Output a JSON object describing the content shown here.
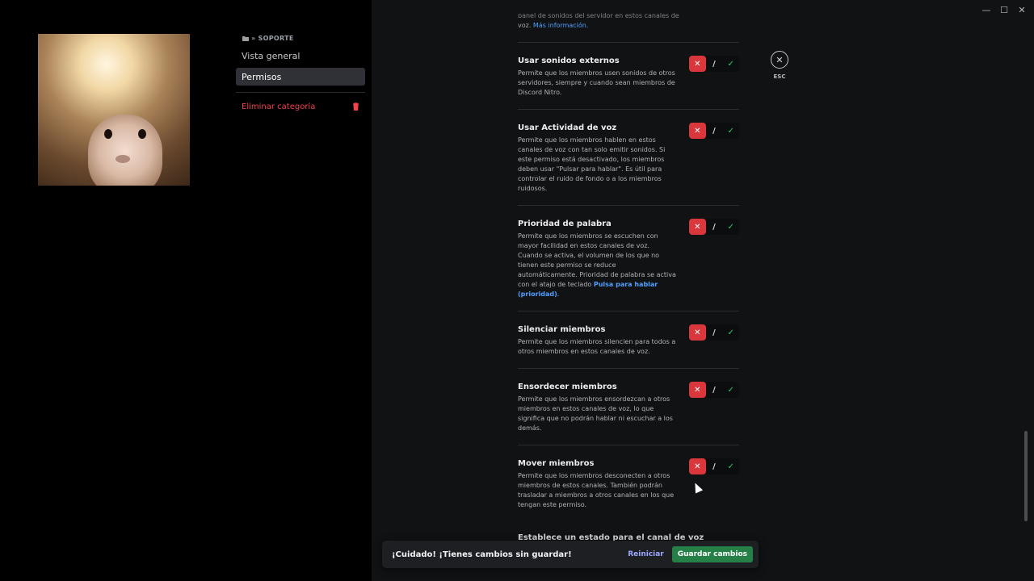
{
  "window": {
    "minimize_glyph": "—",
    "maximize_glyph": "☐",
    "close_glyph": "✕"
  },
  "sidebar": {
    "category_label": "» SOPORTE",
    "items": [
      {
        "label": "Vista general",
        "active": false
      },
      {
        "label": "Permisos",
        "active": true
      }
    ],
    "delete_label": "Eliminar categoría"
  },
  "top_snippet": {
    "clipped_text": "panel de sonidos del servidor en estos canales de",
    "prefix": "voz.",
    "link": "Más información."
  },
  "permissions": [
    {
      "name": "Usar sonidos externos",
      "desc": "Permite que los miembros usen sonidos de otros servidores, siempre y cuando sean miembros de Discord Nitro.",
      "state": "deny"
    },
    {
      "name": "Usar Actividad de voz",
      "desc": "Permite que los miembros hablen en estos canales de voz con tan solo emitir sonidos. Si este permiso está desactivado, los miembros deben usar \"Pulsar para hablar\". Es útil para controlar el ruido de fondo o a los miembros ruidosos.",
      "state": "deny"
    },
    {
      "name": "Prioridad de palabra",
      "desc": "Permite que los miembros se escuchen con mayor facilidad en estos canales de voz. Cuando se activa, el volumen de los que no tienen este permiso se reduce automáticamente. Prioridad de palabra se activa con el atajo de teclado",
      "link": "Pulsa para hablar (prioridad)",
      "link_suffix": ".",
      "state": "deny"
    },
    {
      "name": "Silenciar miembros",
      "desc": "Permite que los miembros silencien para todos a otros miembros en estos canales de voz.",
      "state": "deny"
    },
    {
      "name": "Ensordecer miembros",
      "desc": "Permite que los miembros ensordezcan a otros miembros en estos canales de voz, lo que significa que no podrán hablar ni escuchar a los demás.",
      "state": "deny"
    },
    {
      "name": "Mover miembros",
      "desc": "Permite que los miembros desconecten a otros miembros de estos canales. También podrán trasladar a miembros a otros canales en los que tengan este permiso.",
      "state": "deny"
    }
  ],
  "cut_row_label": "Establece un estado para el canal de voz",
  "toggle_glyphs": {
    "deny": "✕",
    "neutral": "/",
    "allow": "✓"
  },
  "esc": {
    "glyph": "✕",
    "label": "ESC"
  },
  "savebar": {
    "message": "¡Cuidado! ¡Tienes cambios sin guardar!",
    "reset_label": "Reiniciar",
    "save_label": "Guardar cambios"
  },
  "colors": {
    "deny": "#da373c",
    "allow": "#2dc770",
    "save": "#248046",
    "link": "#4ea0ff",
    "danger": "#f2424c"
  }
}
